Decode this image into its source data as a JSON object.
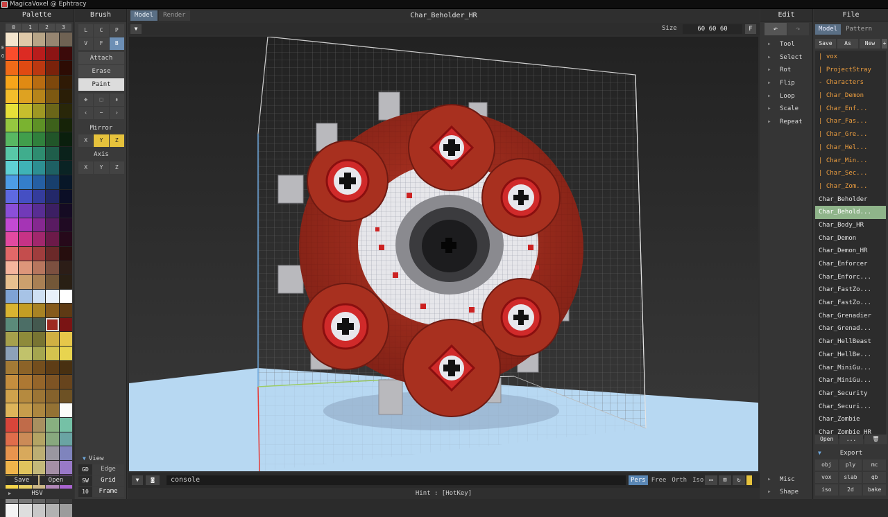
{
  "window": {
    "title": "MagicaVoxel @ Ephtracy"
  },
  "palette": {
    "header": "Palette",
    "tabs": [
      "0",
      "1",
      "2",
      "3"
    ],
    "side_letters": [
      "E",
      "G"
    ],
    "save": "Save",
    "open": "Open",
    "hsv": "HSV",
    "colors": [
      "#f4e5cd",
      "#dfc9a9",
      "#b8a587",
      "#968571",
      "#6f6253",
      "#fa4d2c",
      "#dc2b23",
      "#b81c1c",
      "#8c1414",
      "#3b0a0a",
      "#f06a18",
      "#e04a12",
      "#bb3811",
      "#7a220b",
      "#2d0c04",
      "#f7a51a",
      "#e08a13",
      "#b86c11",
      "#7d480c",
      "#2f1a05",
      "#f3bd2b",
      "#dea221",
      "#b6841a",
      "#7d5912",
      "#2a1e07",
      "#e6e039",
      "#c6be2d",
      "#9f9823",
      "#6b6619",
      "#292709",
      "#95c840",
      "#7ab330",
      "#5e9126",
      "#3d611b",
      "#162308",
      "#58b862",
      "#419e4c",
      "#30803c",
      "#215529",
      "#0a1f0d",
      "#58c8a8",
      "#40ad8d",
      "#2e8c70",
      "#1f5e4b",
      "#0a221b",
      "#5fd1d4",
      "#3fb3b6",
      "#2d8f92",
      "#1e6063",
      "#0a2324",
      "#4d9de6",
      "#347ecb",
      "#255fa3",
      "#183f6d",
      "#081728",
      "#5e69e0",
      "#454fc3",
      "#343c9c",
      "#232869",
      "#0b0e26",
      "#8b4fd8",
      "#713ab8",
      "#582d93",
      "#3c1f63",
      "#150b23",
      "#c34ad4",
      "#a534b5",
      "#852890",
      "#591b61",
      "#200a23",
      "#e24aa1",
      "#c63386",
      "#a1276d",
      "#6c1a49",
      "#26091a",
      "#e26868",
      "#c44d4d",
      "#a03d3d",
      "#6b2929",
      "#260e0e",
      "#f5b59d",
      "#dd967a",
      "#b7765e",
      "#7c5040",
      "#2c1d17",
      "#e7c08f",
      "#cca06d",
      "#a98054",
      "#735738",
      "#291f14",
      "#7fa3d4",
      "#a7c3e6",
      "#cfe0f3",
      "#e8f0fa",
      "#ffffff",
      "#d9b431",
      "#c49d24",
      "#a88324",
      "#855a1c",
      "#5e3a14",
      "#5b8a7a",
      "#4c6e66",
      "#44594f",
      "#9e2b22",
      "#7a1414",
      "#a6a04c",
      "#8e8a3a",
      "#787432",
      "#d0b043",
      "#e6c74a",
      "#8da1b9",
      "#c1c26b",
      "#a5a64f",
      "#d4c34e",
      "#e8d44f",
      "#a47a35",
      "#8c6328",
      "#744e1d",
      "#5e3d16",
      "#483011",
      "#c58e3e",
      "#ad7833",
      "#95652a",
      "#7e5424",
      "#67441d",
      "#cfa24c",
      "#b58a3f",
      "#9c7535",
      "#85622c",
      "#6d5124",
      "#deb55a",
      "#c69d4c",
      "#ad873f",
      "#947234",
      "#fcfcf8",
      "#d8453a",
      "#c06b49",
      "#a89060",
      "#88b080",
      "#75c1a6",
      "#e06d4b",
      "#cb8b57",
      "#b3a464",
      "#88a87e",
      "#6aa4a3",
      "#e8944e",
      "#d8a95c",
      "#bcae73",
      "#9a97a0",
      "#7f84bd",
      "#f0b54b",
      "#e0c45d",
      "#c4b97a",
      "#a48fa6",
      "#9979c8",
      "#f5d54a",
      "#e8d064",
      "#cdb987",
      "#b087b7",
      "#a964d0",
      "#8a8a8a",
      "#767676",
      "#626262",
      "#4e4e4e",
      "#3a3a3a",
      "#f4f4f4",
      "#dedede",
      "#c8c8c8",
      "#b2b2b2",
      "#9c9c9c"
    ]
  },
  "brush": {
    "header": "Brush",
    "modes_row1": [
      "L",
      "C",
      "P"
    ],
    "modes_row2": [
      "V",
      "F",
      "B"
    ],
    "actions": [
      "Attach",
      "Erase",
      "Paint"
    ],
    "tool_icons": [
      "move-icon",
      "select-box-icon",
      "pick-icon"
    ],
    "tool_row2": [
      "‹",
      "−",
      "›"
    ],
    "mirror_label": "Mirror",
    "mirror": [
      "X",
      "Y",
      "Z"
    ],
    "axis_label": "Axis",
    "axis": [
      "X",
      "Y",
      "Z"
    ]
  },
  "view": {
    "header": "View",
    "rows": [
      {
        "key": "GD",
        "value": "Edge"
      },
      {
        "key": "SW",
        "value": "Grid"
      },
      {
        "key": "10",
        "value": "Frame"
      }
    ]
  },
  "center": {
    "tabs": [
      "Model",
      "Render"
    ],
    "title": "Char_Beholder_HR",
    "size_label": "Size",
    "size_value": "60  60  60",
    "f_button": "F",
    "console": "console",
    "projections": [
      "Pers",
      "Free",
      "Orth",
      "Iso"
    ],
    "hint": "Hint : [HotKey]"
  },
  "edit": {
    "header": "Edit",
    "undo": "↶",
    "redo": "↷",
    "items": [
      "Tool",
      "Select",
      "Rot",
      "Flip",
      "Loop",
      "Scale",
      "Repeat"
    ],
    "bottom": [
      "Misc",
      "Shape"
    ]
  },
  "file": {
    "header": "File",
    "tabs": [
      "Model",
      "Pattern"
    ],
    "buttons": [
      "Save",
      "As",
      "New",
      "+"
    ],
    "items": [
      {
        "name": "| vox",
        "folder": true
      },
      {
        "name": "| ProjectStray",
        "folder": true
      },
      {
        "name": "- Characters",
        "folder": true
      },
      {
        "name": "| Char_Demon",
        "folder": true
      },
      {
        "name": "| Char_Enf...",
        "folder": true
      },
      {
        "name": "| Char_Fas...",
        "folder": true
      },
      {
        "name": "| Char_Gre...",
        "folder": true
      },
      {
        "name": "| Char_Hel...",
        "folder": true
      },
      {
        "name": "| Char_Min...",
        "folder": true
      },
      {
        "name": "| Char_Sec...",
        "folder": true
      },
      {
        "name": "| Char_Zom...",
        "folder": true
      },
      {
        "name": "Char_Beholder",
        "folder": false
      },
      {
        "name": "Char_Behold...",
        "folder": false,
        "selected": true
      },
      {
        "name": "Char_Body_HR",
        "folder": false
      },
      {
        "name": "Char_Demon",
        "folder": false
      },
      {
        "name": "Char_Demon_HR",
        "folder": false
      },
      {
        "name": "Char_Enforcer",
        "folder": false
      },
      {
        "name": "Char_Enforc...",
        "folder": false
      },
      {
        "name": "Char_FastZo...",
        "folder": false
      },
      {
        "name": "Char_FastZo...",
        "folder": false
      },
      {
        "name": "Char_Grenadier",
        "folder": false
      },
      {
        "name": "Char_Grenad...",
        "folder": false
      },
      {
        "name": "Char_HellBeast",
        "folder": false
      },
      {
        "name": "Char_HellBe...",
        "folder": false
      },
      {
        "name": "Char_MiniGu...",
        "folder": false
      },
      {
        "name": "Char_MiniGu...",
        "folder": false
      },
      {
        "name": "Char_Security",
        "folder": false
      },
      {
        "name": "Char_Securi...",
        "folder": false
      },
      {
        "name": "Char_Zombie",
        "folder": false
      },
      {
        "name": "Char_Zombie_HR",
        "folder": false
      }
    ],
    "open": "Open",
    "more": "...",
    "export_header": "Export",
    "export": [
      "obj",
      "ply",
      "mc",
      "vox",
      "slab",
      "qb",
      "iso",
      "2d",
      "bake"
    ]
  },
  "colors": {
    "accent": "#5a6f85",
    "selected": "#8fb48a",
    "folder": "#f0a040",
    "yellow": "#e6c23c"
  }
}
